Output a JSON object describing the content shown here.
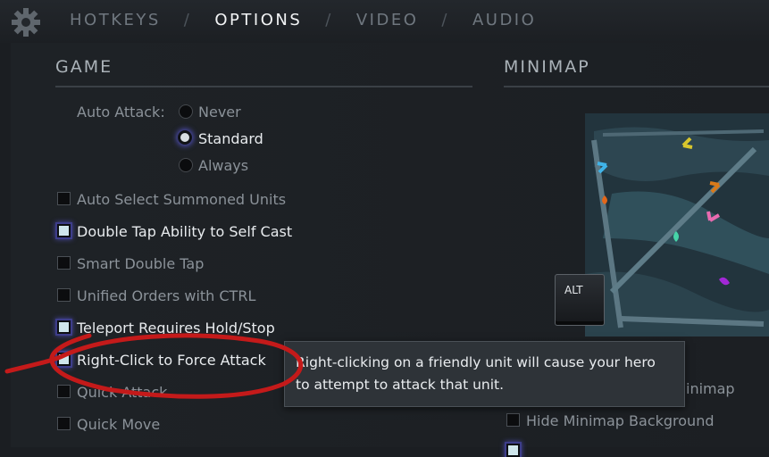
{
  "tabs": [
    {
      "label": "HOTKEYS",
      "active": false
    },
    {
      "label": "OPTIONS",
      "active": true
    },
    {
      "label": "VIDEO",
      "active": false
    },
    {
      "label": "AUDIO",
      "active": false
    }
  ],
  "tab_separator": "/",
  "game": {
    "title": "GAME",
    "auto_attack": {
      "label": "Auto Attack:",
      "options": [
        {
          "label": "Never",
          "selected": false
        },
        {
          "label": "Standard",
          "selected": true
        },
        {
          "label": "Always",
          "selected": false
        }
      ]
    },
    "checkboxes": [
      {
        "label": "Auto Select Summoned Units",
        "checked": false
      },
      {
        "label": "Double Tap Ability to Self Cast",
        "checked": true
      },
      {
        "label": "Smart Double Tap",
        "checked": false
      },
      {
        "label": "Unified Orders with CTRL",
        "checked": false
      },
      {
        "label": "Teleport Requires Hold/Stop",
        "checked": true
      },
      {
        "label": "Right-Click to Force Attack",
        "checked": true
      },
      {
        "label": "Quick Attack",
        "checked": false
      },
      {
        "label": "Quick Move",
        "checked": false
      }
    ]
  },
  "minimap_section": {
    "title": "MINIMAP",
    "alt_key": "ALT",
    "partial_option": "inimap",
    "hide_background": {
      "label": "Hide Minimap Background",
      "checked": false
    }
  },
  "tooltip": {
    "text": "Right-clicking on a friendly unit will cause your hero to attempt to attack that unit."
  },
  "colors": {
    "accent_glow": "#4a4aa8",
    "annotation_red": "#c41a1a",
    "panel_bg": "#1c1f23"
  }
}
